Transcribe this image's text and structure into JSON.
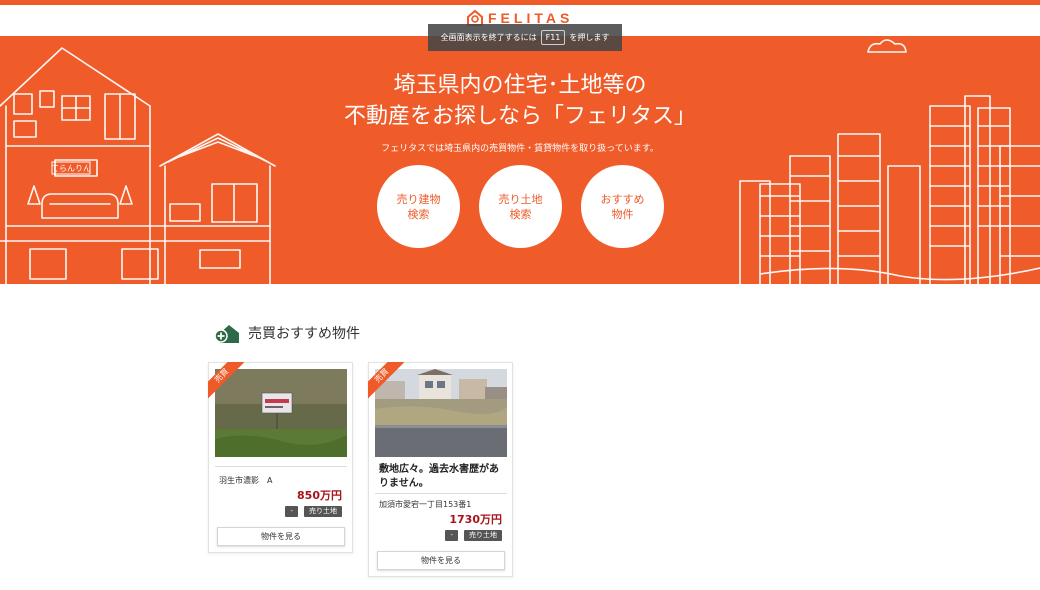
{
  "header": {
    "logo_text": "FELITAS",
    "fullscreen_notice": {
      "before": "全画面表示を終了するには",
      "key": "F11",
      "after": "を押します"
    }
  },
  "hero": {
    "title_line1": "埼玉県内の住宅･土地等の",
    "title_line2": "不動産をお探しなら「フェリタス」",
    "subtitle": "フェリタスでは埼玉県内の売買物件・賃貸物件を取り扱っています。",
    "buttons": [
      {
        "label": "売り建物\n検索"
      },
      {
        "label": "売り土地\n検索"
      },
      {
        "label": "おすすめ\n物件"
      }
    ],
    "shop_sign": "てらんりん"
  },
  "section": {
    "title": "売買おすすめ物件",
    "icon": "house-plus-icon"
  },
  "cards": [
    {
      "ribbon": "売買",
      "name": "羽生市濃影　A",
      "price": "850万円",
      "tags": [
        "-",
        "売り土地"
      ],
      "button": "物件を見る"
    },
    {
      "ribbon": "売買",
      "headline": "敷地広々。過去水害歴がありません。",
      "name": "加須市愛宕一丁目153番1",
      "price": "1730万円",
      "tags": [
        "-",
        "売り土地"
      ],
      "button": "物件を見る"
    }
  ],
  "colors": {
    "brand": "#ef5b29",
    "price": "#a8131b",
    "section_icon": "#2d6b48"
  }
}
